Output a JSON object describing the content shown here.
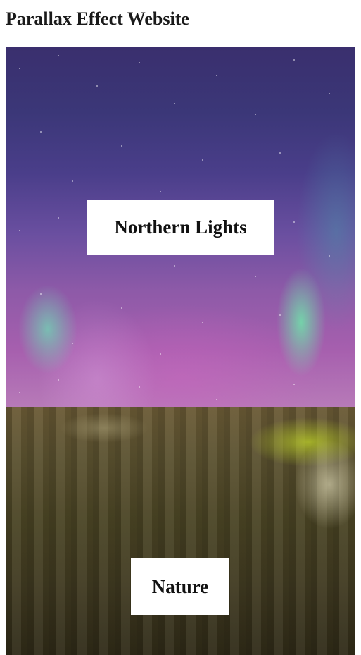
{
  "page": {
    "heading": "Parallax Effect Website"
  },
  "sections": [
    {
      "label": "Northern Lights",
      "image": "aurora-night-sky"
    },
    {
      "label": "Nature",
      "image": "forest-lake-reflection"
    }
  ]
}
